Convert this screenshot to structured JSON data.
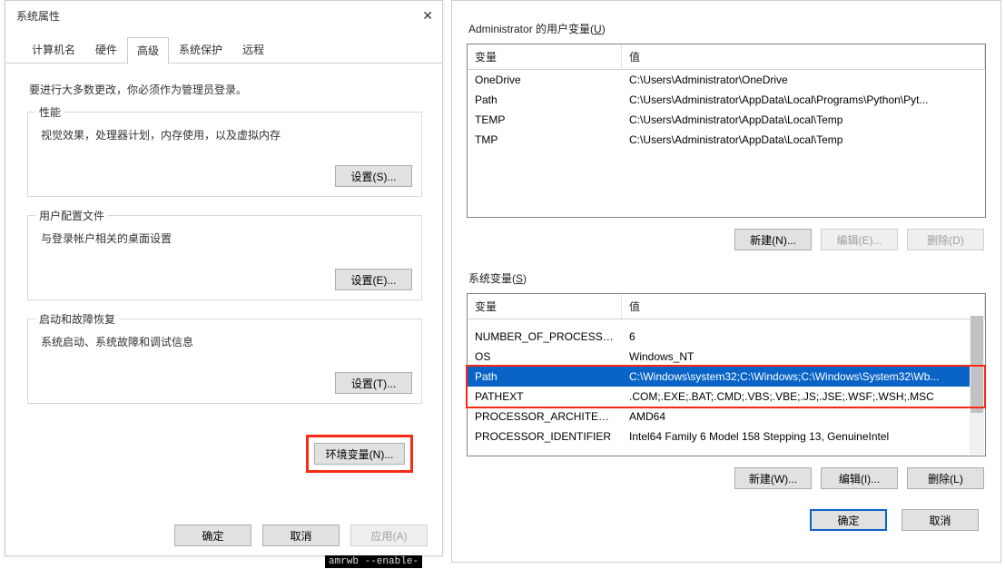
{
  "left": {
    "title": "系统属性",
    "tabs": [
      "计算机名",
      "硬件",
      "高级",
      "系统保护",
      "远程"
    ],
    "active_tab_index": 2,
    "intro": "要进行大多数更改，你必须作为管理员登录。",
    "perf": {
      "title": "性能",
      "text": "视觉效果，处理器计划，内存使用，以及虚拟内存",
      "button": "设置(S)..."
    },
    "profiles": {
      "title": "用户配置文件",
      "text": "与登录帐户相关的桌面设置",
      "button": "设置(E)..."
    },
    "startup": {
      "title": "启动和故障恢复",
      "text": "系统启动、系统故障和调试信息",
      "button": "设置(T)..."
    },
    "env_btn": "环境变量(N)...",
    "ok": "确定",
    "cancel": "取消",
    "apply": "应用(A)"
  },
  "right": {
    "user_label_prefix": "Administrator 的用户变量(",
    "user_label_u": "U",
    "user_label_suffix": ")",
    "sys_label_prefix": "系统变量(",
    "sys_label_u": "S",
    "sys_label_suffix": ")",
    "header_var": "变量",
    "header_val": "值",
    "user_rows": [
      {
        "var": "OneDrive",
        "val": "C:\\Users\\Administrator\\OneDrive"
      },
      {
        "var": "Path",
        "val": "C:\\Users\\Administrator\\AppData\\Local\\Programs\\Python\\Pyt..."
      },
      {
        "var": "TEMP",
        "val": "C:\\Users\\Administrator\\AppData\\Local\\Temp"
      },
      {
        "var": "TMP",
        "val": "C:\\Users\\Administrator\\AppData\\Local\\Temp"
      }
    ],
    "sys_rows": [
      {
        "var": "",
        "val": "",
        "blurred": true
      },
      {
        "var": "NUMBER_OF_PROCESSORS",
        "val": "6"
      },
      {
        "var": "OS",
        "val": "Windows_NT"
      },
      {
        "var": "Path",
        "val": "C:\\Windows\\system32;C:\\Windows;C:\\Windows\\System32\\Wb...",
        "selected": true
      },
      {
        "var": "PATHEXT",
        "val": ".COM;.EXE;.BAT;.CMD;.VBS;.VBE;.JS;.JSE;.WSF;.WSH;.MSC"
      },
      {
        "var": "PROCESSOR_ARCHITECT...",
        "val": "AMD64"
      },
      {
        "var": "PROCESSOR_IDENTIFIER",
        "val": "Intel64 Family 6 Model 158 Stepping 13, GenuineIntel"
      }
    ],
    "btn_new_user": "新建(N)...",
    "btn_edit_user": "编辑(E)...",
    "btn_del_user": "删除(D)",
    "btn_new_sys": "新建(W)...",
    "btn_edit_sys": "编辑(I)...",
    "btn_del_sys": "删除(L)",
    "ok": "确定",
    "cancel": "取消"
  },
  "bg_cmd": "amrwb --enable-"
}
